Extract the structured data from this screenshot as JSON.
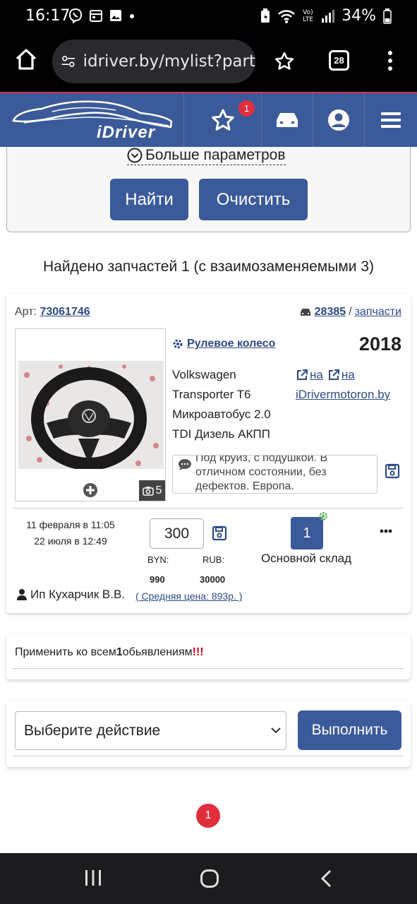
{
  "status_bar": {
    "time": "16:17",
    "battery": "34%",
    "volte_label_top": "Vo)",
    "volte_label_bottom": "LTE"
  },
  "browser": {
    "url": "idriver.by/mylist?part",
    "tab_count": "28"
  },
  "site": {
    "logo_text": "iDriver",
    "favorites_badge": "1"
  },
  "filter": {
    "more_params": "Больше параметров",
    "search_button": "Найти",
    "clear_button": "Очистить"
  },
  "results": {
    "found_text": "Найдено запчастей 1 (с взаимозаменяемыми 3)"
  },
  "card": {
    "art_label": "Арт:",
    "art_number": "73061746",
    "car_id": "28385",
    "car_sep": "/",
    "car_parts_link": "запчасти",
    "photo_count": "5",
    "part_name": "Рулевое колесо",
    "year": "2018",
    "car_lines": [
      "Volkswagen",
      "Transporter T6",
      "Микроавтобус 2.0",
      "TDI Дизель АКПП"
    ],
    "ext_link_1": "на",
    "ext_link_2": "на",
    "ext_site": "iDrivermotoron.by",
    "comment": "Под круиз, с подушкой. В отличном состоянии, без дефектов. Европа.",
    "date_created": "11 февраля в 11:05",
    "date_updated": "22 июля в 12:49",
    "price": "300",
    "byn_label": "BYN:",
    "rub_label": "RUB:",
    "byn_value": "990",
    "rub_value": "30000",
    "quantity": "1",
    "warehouse": "Основной склад",
    "seller": "Ип Кухарчик В.В.",
    "avg_price": "( Средняя цена: 893р. )"
  },
  "apply": {
    "text_before": "Применить ко всем",
    "count": "1",
    "text_after": "обьявлениям",
    "exclaim": "!!!"
  },
  "action": {
    "select_value": "Выберите действие",
    "execute_button": "Выполнить"
  },
  "pagination": {
    "current_page": "1"
  }
}
